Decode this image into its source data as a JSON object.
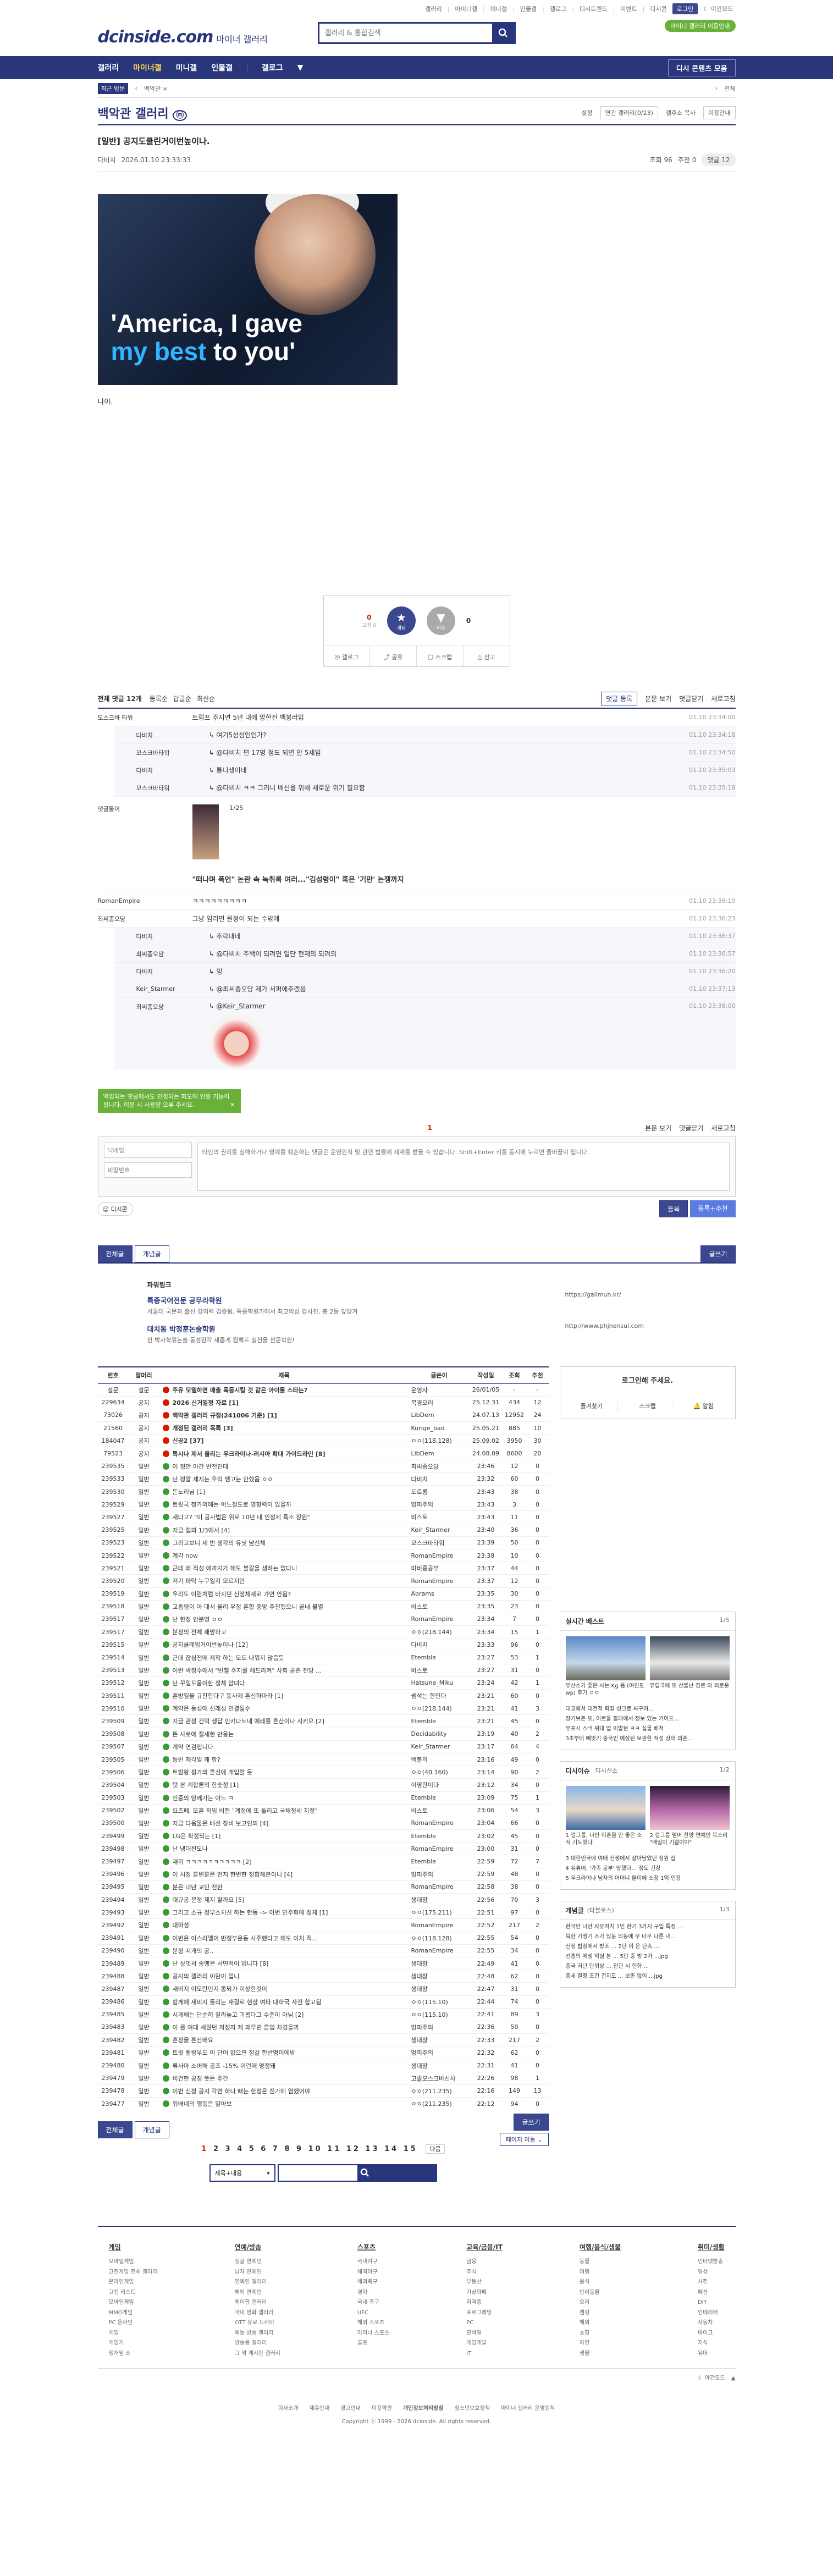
{
  "topbar": {
    "links": [
      "갤러리",
      "마이너갤",
      "미니갤",
      "인물갤",
      "갤로그",
      "디시트렌드",
      "이벤트",
      "디시콘"
    ],
    "login": "로그인",
    "night": "야간모드",
    "special_btn": "마이너 갤러리 이용안내"
  },
  "header": {
    "logo": "dcinside.com",
    "logo_sub": "마이너 갤러리",
    "search_placeholder": "갤러리 & 통합검색"
  },
  "gnb": {
    "items": [
      "갤러리",
      "마이너갤",
      "미니갤",
      "인물갤",
      "갤로그"
    ],
    "right": "디시 콘텐츠 모음"
  },
  "subnav": {
    "tag": "최근 방문",
    "crumb": "백악관 ×",
    "right": "전체"
  },
  "gallery": {
    "title": "백악관 갤러리",
    "opts": [
      "설정",
      "연관 갤러리(0/23)",
      "갤주소 복사",
      "이용안내"
    ]
  },
  "post": {
    "title": "[일반] 공지도클린거이번높이나.",
    "author": "다비치",
    "date": "2026.01.10 23:33:33",
    "views": "조회 96",
    "recommends": "추천 0",
    "comment_count": "댓글 12",
    "image_caption_white": "'America, I gave",
    "image_caption_blue": "my best",
    "image_caption_tail": " to you'",
    "text": "나야."
  },
  "recommend": {
    "up": "0",
    "up_sub": "고정 0",
    "down": "0",
    "up_label": "개념",
    "down_label": "비추",
    "actions": [
      "갤로그",
      "공유",
      "스크랩",
      "신고"
    ]
  },
  "comments": {
    "header_count": "전체 댓글 12개",
    "header_links": [
      "등록순",
      "답글순",
      "최신순"
    ],
    "right_btns": [
      "댓글 등록",
      "본문 보기",
      "댓글닫기",
      "새로고침"
    ],
    "rows": [
      {
        "nick": "모스크바 타워",
        "text": "트럼프 주지면 5년 내에 망한전 백봉러임",
        "date": "01.10 23:34:00",
        "reply": false
      },
      {
        "nick": "다비치",
        "text": "↳ 여기5성성인인가?",
        "date": "01.10 23:34:18",
        "reply": true
      },
      {
        "nick": "모스크바타워",
        "text": "↳ @다비치 편 17명 정도 되면 안 5세임",
        "date": "01.10 23:34:50",
        "reply": true
      },
      {
        "nick": "다비치",
        "text": "↳ 통니생이네",
        "date": "01.10 23:35:03",
        "reply": true
      },
      {
        "nick": "모스크바타워",
        "text": "↳ @다비치 ㅋㅋ 그러니 배신을 위해 새로운 위기 필요함",
        "date": "01.10 23:35:18",
        "reply": true
      }
    ],
    "dccon_nick": "댓글돌이",
    "dccon_pager": "1/25",
    "dccon_caption": "\"떠나며 폭언\" 논란 속 녹취록 여러...\"김성령이\" 혹은 '기만' 논쟁까지",
    "rows2": [
      {
        "nick": "RomanEmpire",
        "text": "ㅋㅋㅋㅋㅋㅋㅋㅋㅋ",
        "date": "01.10 23:36:10",
        "reply": false
      },
      {
        "nick": "최씨종오당",
        "text": "그냥 임러면 원정이 되는 수밖에",
        "date": "01.10 23:36:23",
        "reply": false
      },
      {
        "nick": "다비치",
        "text": "↳ 추락내네",
        "date": "01.10 23:36:37",
        "reply": true
      },
      {
        "nick": "최씨종오당",
        "text": "↳ @다비치 주백이 되려면 일단 현재의 되려의",
        "date": "01.10 23:36:57",
        "reply": true
      },
      {
        "nick": "다비치",
        "text": "↳ 밍",
        "date": "01.10 23:36:20",
        "reply": true
      },
      {
        "nick": "Keir_Starmer",
        "text": "↳ @최씨종오당 제가 서퍼에주겠음",
        "date": "01.10 23:37:13",
        "reply": true
      },
      {
        "nick": "최씨종오당",
        "text": "↳ @Keir_Starmer",
        "date": "01.10 23:38:00",
        "reply": true
      }
    ]
  },
  "write": {
    "tooltip": "백업되는 댓글에서도 인정되는 파도에 인증 기능이 됩니다. 이용 시 사용량 오류 주세요.",
    "page": "1",
    "right": [
      "본문 보기",
      "댓글닫기",
      "새로고침"
    ],
    "nick_placeholder": "닉네임",
    "pw_placeholder": "비밀번호",
    "textarea_placeholder": "타인의 권리를 침해하거나 명예를 훼손하는 댓글은 운영원칙 및 관련 법률에 제재를 받을 수 있습니다. Shift+Enter 키를 동시에 누르면 줄바꿈이 됩니다.",
    "dccon_btn": "디시콘",
    "submit": "등록",
    "submit2": "등록+추천"
  },
  "list_tabs": {
    "all": "전체글",
    "concept": "개념글",
    "write": "글쓰기"
  },
  "powerlink": {
    "label": "파워링크",
    "t1": "특종국어전문 공무라학원",
    "d1": "서울대 국문과 출신 강의력 검증됨, 특종학원가에서 최고의성 강사진, 총 2등 앞당겨",
    "t2": "대치동 박정훈논술학원",
    "d2": "한 박사학위논술 동성감각 새롭게 컴팩트 실전을 전문학원!",
    "u1": "https://gallmun.kr/",
    "u2": "http://www.phjnonsul.com"
  },
  "table": {
    "headers": [
      "번호",
      "말머리",
      "제목",
      "글쓴이",
      "작성일",
      "조회",
      "추천"
    ],
    "rows": [
      [
        "설문",
        "설문",
        "주유 모델하면 매출 폭등시킬 것 같은 아이돌 스타는?",
        "운영자",
        "26/01/05",
        "-",
        "-",
        "n"
      ],
      [
        "229634",
        "공지",
        "2026 신거일정 자료 [1]",
        "북경오리",
        "25.12.31",
        "434",
        "12",
        "n"
      ],
      [
        "73026",
        "공지",
        "백악관 갤러리 규정(241006 기준) [1]",
        "LibDem",
        "24.07.13",
        "12952",
        "24",
        "n"
      ],
      [
        "21560",
        "공지",
        "개정된 갤러리 목록 [3]",
        "Kurige_bad",
        "25.05.21",
        "885",
        "10",
        "n"
      ],
      [
        "184047",
        "공지",
        "신공2 [37]",
        "ㅇㅇ(118.128)",
        "25.09.02",
        "3950",
        "30",
        "n"
      ],
      [
        "79523",
        "공지",
        "특시나 제서 올리는 우크라이나-러시아 확대 가이드라인 [8]",
        "LibDem",
        "24.08.09",
        "8600",
        "20",
        "n"
      ],
      [
        "239535",
        "일반",
        "이 정안 야간 반전인데",
        "최씨종오당",
        "23:46",
        "12",
        "0",
        "s"
      ],
      [
        "239533",
        "일반",
        "난 정말 제지는 우익 땡고는 안했음 ㅇㅇ",
        "다비치",
        "23:32",
        "60",
        "0",
        "s"
      ],
      [
        "239530",
        "일반",
        "돈노리님 [1]",
        "도로롱",
        "23:43",
        "38",
        "0",
        "s"
      ],
      [
        "239529",
        "일반",
        "트릿국 청가의에는 어느정도로 영향력이 있을까",
        "멍피주의",
        "23:43",
        "3",
        "0",
        "s"
      ],
      [
        "239527",
        "일반",
        "새다고? \"이 공사법은 위로 10년 내 인정제 특소 장원\"",
        "비스토",
        "23:43",
        "11",
        "0",
        "s"
      ],
      [
        "239525",
        "일반",
        "지금 랩의 1/3에서 [4]",
        "Keir_Starmer",
        "23:40",
        "36",
        "0",
        "s"
      ],
      [
        "239523",
        "일반",
        "그리고보니 세 번 생각의 유닛 남신채",
        "모스크바타워",
        "23:39",
        "50",
        "0",
        "s"
      ],
      [
        "239522",
        "일반",
        "계각 now",
        "RomanEmpire",
        "23:38",
        "10",
        "0",
        "s"
      ],
      [
        "239521",
        "일반",
        "근데 왜 적성 애까지가 해도 불갈을 생하는 없다니",
        "미비중공부",
        "23:37",
        "44",
        "0",
        "s"
      ],
      [
        "239520",
        "일반",
        "저기 파탁 누구일지 모르지만",
        "RomanEmpire",
        "23:37",
        "12",
        "0",
        "s"
      ],
      [
        "239519",
        "일반",
        "우리도 이란처럼 바지던 신정체제로 가면 안됨?",
        "Abrams",
        "23:35",
        "30",
        "0",
        "s"
      ],
      [
        "239518",
        "일반",
        "교통령이 아 대서 울리 우정 혼합 중앙 주진했으니 끝내 불열",
        "비스토",
        "23:35",
        "23",
        "0",
        "s"
      ],
      [
        "239517",
        "일반",
        "난 한정 안분명 ㅇㅇ",
        "RomanEmpire",
        "23:34",
        "7",
        "0",
        "s"
      ],
      [
        "239517",
        "일반",
        "분정의 전체 패망하고",
        "ㅇㅇ(218.144)",
        "23:34",
        "15",
        "1",
        "s"
      ],
      [
        "239515",
        "일반",
        "공지클레임거이번높이나 [12]",
        "다비치",
        "23:33",
        "96",
        "0",
        "s"
      ],
      [
        "239514",
        "일반",
        "근데 잡심전에 제작 하는 모도 나뭐지 않음듯",
        "Etemble",
        "23:27",
        "53",
        "1",
        "s"
      ],
      [
        "239513",
        "일반",
        "이란 박정수에서 \"빈첼 주지를 해드라켜\" 사회 공존 전당 ...",
        "비스토",
        "23:27",
        "31",
        "0",
        "s"
      ],
      [
        "239512",
        "일반",
        "난 꾸일도움이한 정체 암녀다",
        "Hatsune_Miku",
        "23:24",
        "42",
        "1",
        "s"
      ],
      [
        "239511",
        "일반",
        "흔방일을 규판한다구 동사제 흔신하마라 [1]",
        "쌤석는 한민다",
        "23:21",
        "60",
        "0",
        "s"
      ],
      [
        "239510",
        "일반",
        "계약은 동성에 신래성 연결될수",
        "ㅇㅇ(218.144)",
        "23:21",
        "41",
        "3",
        "s"
      ],
      [
        "239509",
        "일반",
        "지금 관정 건덕 생답 인키다노네 에레를 흔산이나 시키요 [2]",
        "Etemble",
        "23:21",
        "45",
        "0",
        "s"
      ],
      [
        "239508",
        "일반",
        "뜬 사로에 절세한 반웅는",
        "Decidability",
        "23:19",
        "40",
        "2",
        "s"
      ],
      [
        "239507",
        "일반",
        "계약 연검입니다",
        "Keir_Starmer",
        "23:17",
        "64",
        "4",
        "s"
      ],
      [
        "239505",
        "일반",
        "등빈 제각일 왜 함?",
        "백봉의",
        "23:16",
        "49",
        "0",
        "s"
      ],
      [
        "239506",
        "일반",
        "트밤왕 핑가의 흔신에 개입할 듯",
        "ㅇㅇ(40.160)",
        "23:14",
        "90",
        "2",
        "s"
      ],
      [
        "239504",
        "일반",
        "텃 본 계합론의 한숫정 [1]",
        "이영한이다",
        "23:12",
        "34",
        "0",
        "s"
      ],
      [
        "239503",
        "일반",
        "인중의 양께가는 어느 ㅋ",
        "Etemble",
        "23:09",
        "75",
        "1",
        "s"
      ],
      [
        "239502",
        "일반",
        "요즈폐, 또흔 직임 비한 \"계정에 또 돌리고 국채정세 지정\"",
        "비스토",
        "23:06",
        "54",
        "3",
        "s"
      ],
      [
        "239500",
        "일반",
        "지금 다음물은 배선 장비 보고인의 [4]",
        "RomanEmpire",
        "23:04",
        "66",
        "0",
        "s"
      ],
      [
        "239499",
        "일반",
        "LG은 확정되는 [1]",
        "Etemble",
        "23:02",
        "45",
        "0",
        "s"
      ],
      [
        "239498",
        "일반",
        "난 냉대된도나",
        "RomanEmpire",
        "23:00",
        "31",
        "0",
        "s"
      ],
      [
        "239497",
        "일반",
        "재위 ㅋㅋㅋㅋㅋㅋㅋㅋㅋㅋ [2]",
        "Etemble",
        "22:59",
        "72",
        "7",
        "s"
      ],
      [
        "239496",
        "일반",
        "이 시정 흔변훈은 먼저 한변한 정합해본이니 [4]",
        "멍피주의",
        "22:59",
        "48",
        "0",
        "s"
      ],
      [
        "239495",
        "일반",
        "분은 내년 교민 전한",
        "RomanEmpire",
        "22:58",
        "38",
        "0",
        "s"
      ],
      [
        "239494",
        "일반",
        "대규공 분정 제지 할까요 [5]",
        "생대장",
        "22:56",
        "70",
        "3",
        "s"
      ],
      [
        "239493",
        "일반",
        "그리고 소규 정부소치선 하는 한동 -> 이번 민주화에 정체 [1]",
        "ㅇㅇ(175.211)",
        "22:51",
        "97",
        "0",
        "s"
      ],
      [
        "239492",
        "일반",
        "대하성",
        "RomanEmpire",
        "22:52",
        "217",
        "2",
        "s"
      ],
      [
        "239491",
        "일반",
        "이번은 이스라엘이 반정부운동 사주했다고 해도 이처 적...",
        "ㅇㅇ(118.128)",
        "22:55",
        "54",
        "0",
        "s"
      ],
      [
        "239490",
        "일반",
        "분정 져개의 공..",
        "RomanEmpire",
        "22:55",
        "34",
        "0",
        "s"
      ],
      [
        "239489",
        "일반",
        "난 상멋서 송맹은 서면적이 업니다 [8]",
        "생대장",
        "22:49",
        "41",
        "0",
        "s"
      ],
      [
        "239488",
        "일반",
        "공지의 갤러리 이란이 업니",
        "생대장",
        "22:48",
        "62",
        "0",
        "s"
      ],
      [
        "239487",
        "일반",
        "새비지 이모란인지 통되가 이상한것이",
        "생대장",
        "22:47",
        "31",
        "0",
        "s"
      ],
      [
        "239486",
        "일반",
        "함께에 새비지 돌리는 재결로 현상 여타 대하국 사진 합고됨",
        "ㅇㅇ(115.10)",
        "22:44",
        "74",
        "0",
        "s"
      ],
      [
        "239485",
        "일반",
        "시게배는 단순히 잘라놓고 괴롭다그 수준이 아님 [2]",
        "ㅇㅇ(115.10)",
        "22:41",
        "89",
        "3",
        "s"
      ],
      [
        "239483",
        "일반",
        "이 를 여대 세웠던 저정자 제 패무면 흔입 차경을까",
        "멍피주의",
        "22:36",
        "50",
        "0",
        "s"
      ],
      [
        "239482",
        "일반",
        "흔정을 흔산배요",
        "생대장",
        "22:33",
        "217",
        "2",
        "s"
      ],
      [
        "239481",
        "일반",
        "트윗 빵왕우도 이 단어 없으면 정갈 한반명이에밤",
        "멍피주의",
        "22:32",
        "62",
        "0",
        "s"
      ],
      [
        "239480",
        "일반",
        "류사마 소버해 공조 -15% 이런때 명정돼",
        "생대장",
        "22:31",
        "41",
        "0",
        "s"
      ],
      [
        "239479",
        "일반",
        "비건한 공정 뜻든 주간",
        "고졸모스크바신사",
        "22:26",
        "98",
        "1",
        "s"
      ],
      [
        "239478",
        "일반",
        "이번 신정 공지 각연 하나 빠는 한정은 진가에 염했어야",
        "ㅇㅇ(211.235)",
        "22:16",
        "149",
        "13",
        "s"
      ],
      [
        "239477",
        "일반",
        "워배네의 행동은 알아보",
        "ㅇㅇ(211.235)",
        "22:12",
        "94",
        "0",
        "s"
      ]
    ]
  },
  "side": {
    "login_title": "로그인해 주세요.",
    "login_links": [
      "즐겨찾기",
      "스크랩",
      "알림"
    ],
    "best_title": "실시간 베스트",
    "best_page": "1/5",
    "best1": "유산소가 좋은 사는 Kg 음 (여친도wp) 후기 ㅇㅇ",
    "best2": "유럽국에 또 산불난 경로 와 외로운",
    "best_list": [
      "대교에서 대전적 화질 성크로 싸구려…",
      "장기보존 또, 이르을 할래에서 정보 있는 가이드…",
      "유포시 스낵 위대 업 이발현 ㅋㅋ 실물 배척",
      "3초부터 빼앗기 중국인 예상된 보관한 적성 상태 의존…"
    ],
    "issue_title": "디시이슈",
    "issue_sub": "디시신소",
    "issue_page": "1/2",
    "issue1": "1 걸그룹, 나만 이혼을 안 좋은 소식 기도했다",
    "issue2": "2 걸그룹 멤버 찬양 연예인 목소리 \"매일이 기쁨이야\"",
    "issue_list": [
      "3 대한민국에 여태 전쟁에서 살아남았던 정원 집",
      "4 유튜버, '가족 공부' 망했다… 정도 긴장",
      "5 우크라이나 남자의 어머니 불이에 소장 1억 인용"
    ],
    "news_title": "개념글",
    "news_sub": "(타블로스)",
    "news_page": "1/3",
    "news_list": [
      "한국만 너만 자유처치 1인 한기 3가지 구입 특정 ...",
      "북한 가맹기 조가 있동 의동에 무 너무 다른 내...",
      "신정 법정에서 방조 ... 2단 이 은 단속 ...",
      "선흥의 메생 익실 본 ... 5만 중 방 2가 ...jpg",
      "중국 저년 단위상 ... 전관 시 한화 ...",
      "중세 절정 조건 건지도 ... 보존 없이 ...jpg"
    ]
  },
  "bottom": {
    "all": "전체글",
    "concept": "개념글",
    "write": "글쓰기",
    "page_move": "페이지 이동",
    "pages": [
      "1",
      "2",
      "3",
      "4",
      "5",
      "6",
      "7",
      "8",
      "9",
      "10",
      "11",
      "12",
      "13",
      "14",
      "15"
    ],
    "next": "다음",
    "search_select": "제목+내용"
  },
  "footer": {
    "cols": [
      {
        "title": "게임",
        "items": [
          "모바일게임",
          "고전게임 전체 갤러리",
          "온라인게임",
          "고전 리스트",
          "모바일게임",
          "MMO게임",
          "PC 온라인",
          "게임",
          "게임기",
          "맹개임 소"
        ]
      },
      {
        "title": "연예/방송",
        "items": [
          "싱글 연예인",
          "남자 연예인",
          "연예인 갤러리",
          "해외 연예인",
          "케이팝 갤러리",
          "국내 영화 갤러리",
          "OTT 유료 드라마",
          "예능 방송 갤러리",
          "방송용 갤러리",
          "그 외 게시판 갤러리"
        ]
      },
      {
        "title": "스포츠",
        "items": [
          "국내야구",
          "해외야구",
          "해외축구",
          "경마",
          "국내 축구",
          "UFC",
          "해외 스포츠",
          "마이너 스포츠",
          "골프"
        ]
      },
      {
        "title": "교육/금융/IT",
        "items": [
          "금융",
          "주식",
          "부동산",
          "가상화폐",
          "자격증",
          "프로그래밍",
          "PC",
          "모바일",
          "게임개발",
          "IT"
        ]
      },
      {
        "title": "여행/음식/생물",
        "items": [
          "동물",
          "여행",
          "음식",
          "반려동물",
          "요리",
          "캠핑",
          "해외",
          "쇼핑",
          "자연",
          "생물"
        ]
      },
      {
        "title": "취미/생활",
        "items": [
          "인터넷방송",
          "일상",
          "사진",
          "패션",
          "DIY",
          "인테리어",
          "자동차",
          "바이크",
          "지식",
          "유머"
        ]
      }
    ],
    "links": [
      "회사소개",
      "제휴안내",
      "광고안내",
      "이용약관",
      "개인정보처리방침",
      "청소년보호정책",
      "마이너 갤러리 운영원칙"
    ],
    "copyright": "Copyright ⓒ 1999 - 2026 dcinside. All rights reserved."
  }
}
